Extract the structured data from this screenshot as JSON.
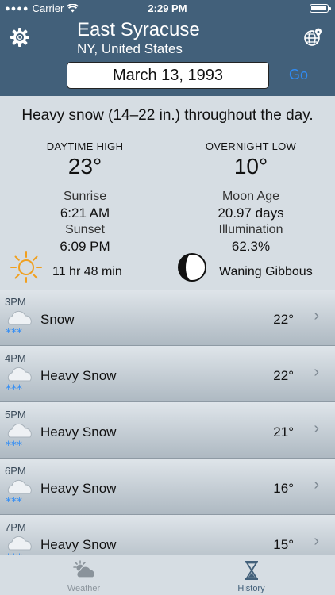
{
  "status_bar": {
    "carrier": "Carrier",
    "time": "2:29 PM"
  },
  "header": {
    "city": "East Syracuse",
    "region": "NY, United States",
    "date_value": "March 13, 1993",
    "go_label": "Go",
    "accent_color": "#42607a",
    "link_color": "#2f8cf6"
  },
  "summary": {
    "headline": "Heavy snow (14–22 in.) throughout the day.",
    "daytime_high_label": "DAYTIME HIGH",
    "daytime_high": "23°",
    "overnight_low_label": "OVERNIGHT LOW",
    "overnight_low": "10°",
    "sunrise_label": "Sunrise",
    "sunrise": "6:21 AM",
    "sunset_label": "Sunset",
    "sunset": "6:09 PM",
    "day_length": "11 hr 48 min",
    "moon_age_label": "Moon Age",
    "moon_age": "20.97 days",
    "illumination_label": "Illumination",
    "illumination": "62.3%",
    "moon_phase": "Waning Gibbous"
  },
  "hourly": [
    {
      "hour": "3PM",
      "condition": "Snow",
      "temp": "22°",
      "icon": "snow-cloud-icon"
    },
    {
      "hour": "4PM",
      "condition": "Heavy Snow",
      "temp": "22°",
      "icon": "snow-cloud-icon"
    },
    {
      "hour": "5PM",
      "condition": "Heavy Snow",
      "temp": "21°",
      "icon": "snow-cloud-icon"
    },
    {
      "hour": "6PM",
      "condition": "Heavy Snow",
      "temp": "16°",
      "icon": "snow-cloud-icon"
    },
    {
      "hour": "7PM",
      "condition": "Heavy Snow",
      "temp": "15°",
      "icon": "snow-cloud-icon"
    }
  ],
  "tabs": {
    "weather_label": "Weather",
    "history_label": "History",
    "active": "History"
  }
}
